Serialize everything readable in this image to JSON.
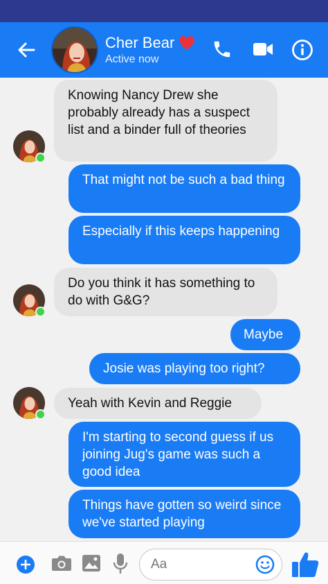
{
  "header": {
    "contact_name": "Cher Bear",
    "status": "Active now",
    "heart_emoji": "❤"
  },
  "messages": [
    {
      "side": "in",
      "text": "Knowing Nancy Drew she probably already has a suspect list and a binder full of theories"
    },
    {
      "side": "out",
      "text": "That might not be such a bad thing"
    },
    {
      "side": "out",
      "text": "Especially if this keeps happening"
    },
    {
      "side": "in",
      "text": "Do you think it has something to do with G&G?"
    },
    {
      "side": "out",
      "text": "Maybe"
    },
    {
      "side": "out",
      "text": "Josie was playing too right?"
    },
    {
      "side": "in",
      "text": "Yeah with Kevin and Reggie"
    },
    {
      "side": "out",
      "text": "I'm starting to second guess if us joining Jug's game was such a good idea"
    },
    {
      "side": "out",
      "text": "Things have gotten so weird since we've started playing"
    }
  ],
  "composer": {
    "placeholder": "Aa"
  },
  "colors": {
    "accent": "#1a7cf5",
    "status_bar": "#2b3a8f",
    "incoming_bubble": "#e4e4e4",
    "online": "#3fd34a"
  }
}
